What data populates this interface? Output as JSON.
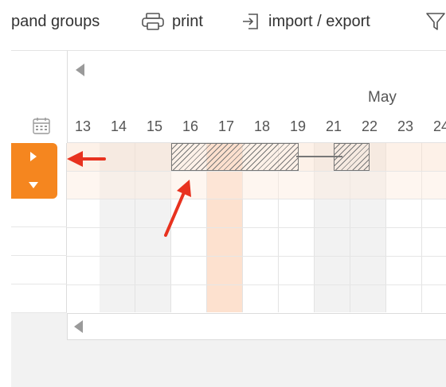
{
  "toolbar": {
    "expand_label": "pand groups",
    "print_label": "print",
    "import_label": "import / export"
  },
  "timescale": {
    "month": "May",
    "days": [
      "13",
      "14",
      "15",
      "16",
      "17",
      "18",
      "19",
      "21",
      "22",
      "23",
      "24"
    ]
  },
  "colors": {
    "accent": "#f5861f",
    "today_column": "#fde1cf",
    "annotation_arrow": "#e8321f"
  },
  "icons": [
    "printer-icon",
    "import-icon",
    "filter-icon",
    "calendar-icon",
    "scroll-left-icon",
    "expand-row-icon",
    "collapse-row-icon"
  ]
}
